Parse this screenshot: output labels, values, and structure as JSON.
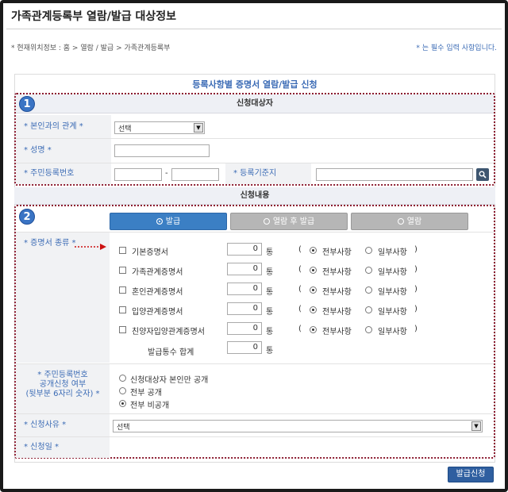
{
  "page": {
    "title": "가족관계등록부 열람/발급 대상정보",
    "breadcrumb": "* 현재위치정보 : 홈 > 열람 / 발급 > 가족관계등록부",
    "required_note": "* 는 필수 입력 사항입니다."
  },
  "form_title": "등록사항별 증명서 열람/발급 신청",
  "section1": {
    "number": "1",
    "header": "신청대상자",
    "relation_label": "* 본인과의 관계 *",
    "relation_value": "선택",
    "name_label": "* 성명 *",
    "rrn_label": "* 주민등록번호",
    "rrn_dash": "-",
    "reg_base_label": "* 등록기준지"
  },
  "section2": {
    "number": "2",
    "header": "신청내용",
    "tabs": [
      {
        "label": "발급",
        "active": true
      },
      {
        "label": "열람 후 발급",
        "active": false
      },
      {
        "label": "열람",
        "active": false
      }
    ],
    "cert_type_label": "* 증명서 종류 *",
    "unit": "통",
    "paren_open": "(",
    "paren_close": ")",
    "opt_all": "전부사항",
    "opt_partial": "일부사항",
    "certificates": [
      {
        "name": "기본증명서",
        "qty": "0"
      },
      {
        "name": "가족관계증명서",
        "qty": "0"
      },
      {
        "name": "혼인관계증명서",
        "qty": "0"
      },
      {
        "name": "입양관계증명서",
        "qty": "0"
      },
      {
        "name": "친양자입양관계증명서",
        "qty": "0"
      }
    ],
    "total_label": "발급통수 합계",
    "total_value": "0",
    "rrn_disclosure_label": [
      "* 주민등록번호",
      "공개신청 여부",
      "(뒷부분 6자리 숫자) *"
    ],
    "rrn_options": [
      {
        "label": "신청대상자 본인만 공개",
        "selected": false
      },
      {
        "label": "전부 공개",
        "selected": false
      },
      {
        "label": "전부 비공개",
        "selected": true
      }
    ],
    "reason_label": "* 신청사유 *",
    "reason_value": "선택",
    "date_label": "* 신청일 *"
  },
  "submit_label": "발급신청",
  "colors": {
    "accent": "#3b6bb5",
    "dotted_border": "#8b1a2f",
    "active_tab": "#3b7fc4",
    "inactive_tab": "#b6b6b6",
    "submit": "#2f5fa0"
  }
}
